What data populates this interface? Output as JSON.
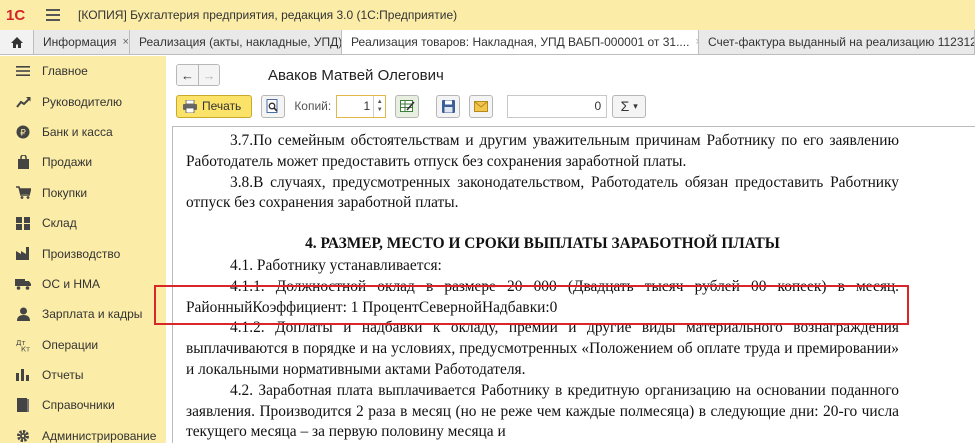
{
  "app": {
    "logo": "1С",
    "title": "[КОПИЯ] Бухгалтерия предприятия, редакция 3.0  (1С:Предприятие)"
  },
  "tabs": [
    {
      "label": "Информация",
      "close": "×"
    },
    {
      "label": "Реализация (акты, накладные, УПД)",
      "close": "×"
    },
    {
      "label": "Реализация товаров: Накладная, УПД ВАБП-000001 от 31....",
      "close": "×"
    },
    {
      "label": "Счет-фактура выданный на реализацию 1123123123",
      "close": ""
    }
  ],
  "sidebar": {
    "items": [
      {
        "label": "Главное",
        "icon": "menu-icon"
      },
      {
        "label": "Руководителю",
        "icon": "trend-icon"
      },
      {
        "label": "Банк и касса",
        "icon": "coins-icon"
      },
      {
        "label": "Продажи",
        "icon": "bag-icon"
      },
      {
        "label": "Покупки",
        "icon": "cart-icon"
      },
      {
        "label": "Склад",
        "icon": "warehouse-icon"
      },
      {
        "label": "Производство",
        "icon": "factory-icon"
      },
      {
        "label": "ОС и НМА",
        "icon": "truck-icon"
      },
      {
        "label": "Зарплата и кадры",
        "icon": "person-icon"
      },
      {
        "label": "Операции",
        "icon": "operations-icon"
      },
      {
        "label": "Отчеты",
        "icon": "chart-icon"
      },
      {
        "label": "Справочники",
        "icon": "book-icon"
      },
      {
        "label": "Администрирование",
        "icon": "gear-icon"
      }
    ]
  },
  "header": {
    "title": "Аваков Матвей Олегович",
    "back": "←",
    "forward": "→"
  },
  "toolbar": {
    "print_label": "Печать",
    "copies_label": "Копий:",
    "copies_value": "1",
    "number_value": "0",
    "sum_label": "Σ",
    "sum_dropdown": "▾"
  },
  "document": {
    "p1": "3.7.По семейным обстоятельствам и другим уважительным причинам Работнику по его заявлению Работодатель может предоставить отпуск без сохранения заработной платы.",
    "p2": "3.8.В случаях, предусмотренных законодательством, Работодатель обязан предоставить Работнику отпуск без сохранения заработной платы.",
    "heading": "4. РАЗМЕР, МЕСТО И СРОКИ ВЫПЛАТЫ ЗАРАБОТНОЙ ПЛАТЫ",
    "p3": "4.1. Работнику устанавливается:",
    "p4": "4.1.1. Должностной оклад в размере 20 000 (Двадцать тысяч рублей 00 копеек) в месяц. РайонныйКоэффициент: 1 ПроцентСевернойНадбавки:0",
    "p5": "4.1.2. Доплаты и надбавки к окладу, премии и другие виды материального вознаграждения выплачиваются в порядке и на условиях, предусмотренных «Положением об оплате труда и премировании» и локальными нормативными актами Работодателя.",
    "p6": "4.2. Заработная плата выплачивается Работнику в кредитную организацию на основании поданного заявления. Производится 2 раза в месяц (но не реже чем каждые полмесяца) в следующие дни: 20-го числа текущего месяца – за первую половину месяца и"
  },
  "colors": {
    "titlebar_bg": "#fbeca7",
    "accent": "#fbe36a",
    "highlight": "#d9262a",
    "logo": "#d2232a"
  }
}
